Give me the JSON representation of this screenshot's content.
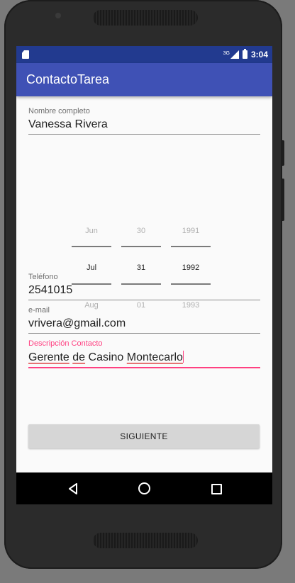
{
  "status_bar": {
    "network": "3G",
    "time": "3:04"
  },
  "app_bar": {
    "title": "ContactoTarea"
  },
  "form": {
    "name": {
      "label": "Nombre completo",
      "value": "Vanessa Rivera"
    },
    "date_picker": {
      "month": {
        "prev": "Jun",
        "selected": "Jul",
        "next": "Aug"
      },
      "day": {
        "prev": "30",
        "selected": "31",
        "next": "01"
      },
      "year": {
        "prev": "1991",
        "selected": "1992",
        "next": "1993"
      }
    },
    "phone": {
      "label": "Teléfono",
      "value": "2541015"
    },
    "email": {
      "label": "e-mail",
      "value": "vrivera@gmail.com"
    },
    "description": {
      "label": "Descripción Contacto",
      "value_parts": [
        "Gerente",
        "de",
        "Casino",
        "Montecarlo"
      ]
    },
    "submit_label": "SIGUIENTE"
  },
  "colors": {
    "status_bar": "#223a8f",
    "app_bar": "#3f51b5",
    "accent": "#ff4081"
  }
}
